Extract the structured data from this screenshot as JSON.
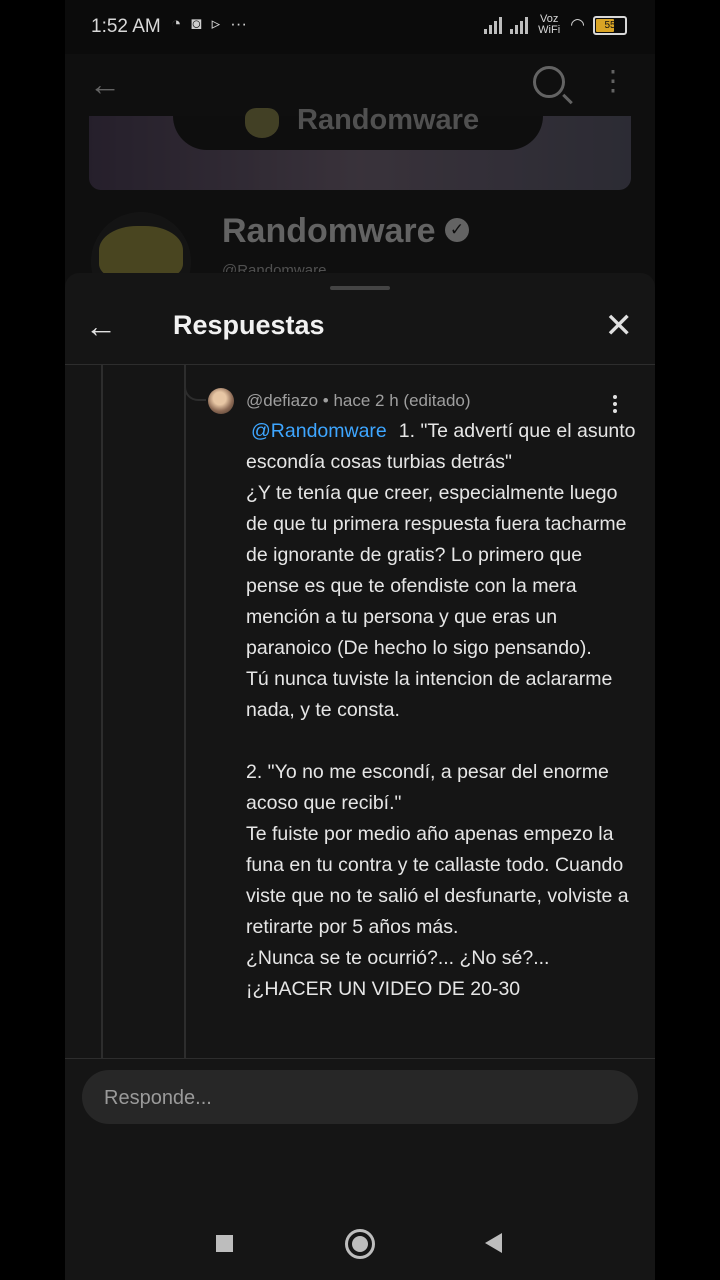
{
  "status_bar": {
    "time": "1:52 AM",
    "left_icons": [
      "whatsapp-icon",
      "discord-icon",
      "play-icon",
      "more-dots-icon"
    ],
    "network_label": "Voz WiFi",
    "battery": "55"
  },
  "app_header": {
    "icons": [
      "back-arrow-icon",
      "search-icon",
      "more-vert-icon"
    ]
  },
  "channel": {
    "banner_text": "Randomware",
    "name": "Randomware",
    "handle": "@Randomware"
  },
  "replies_sheet": {
    "title": "Respuestas",
    "reply": {
      "meta": "@defiazo • hace 2 h (editado)",
      "mention": "@Randomware",
      "text": "1. \"Te advertí que el asunto escondía cosas turbias detrás\"\n¿Y te tenía que creer, especialmente luego de que tu primera respuesta fuera tacharme de ignorante de gratis? Lo primero que pense es que te ofendiste con la mera mención a tu persona y que eras un paranoico (De hecho lo sigo pensando).\nTú nunca tuviste la intencion de aclararme nada, y te consta.\n\n2. \"Yo no me escondí, a pesar del enorme acoso que recibí.\"\nTe fuiste por medio año apenas empezo la funa en tu contra y te callaste todo. Cuando viste que no te salió el desfunarte, volviste a retirarte por 5 años más.\n¿Nunca se te ocurrió?... ¿No sé?...\n¡¿HACER UN VIDEO DE 20-30"
    },
    "composer": {
      "placeholder": "Responde..."
    }
  },
  "nav_bar": {
    "icons": [
      "recents-square-icon",
      "home-circle-icon",
      "back-triangle-icon"
    ]
  }
}
